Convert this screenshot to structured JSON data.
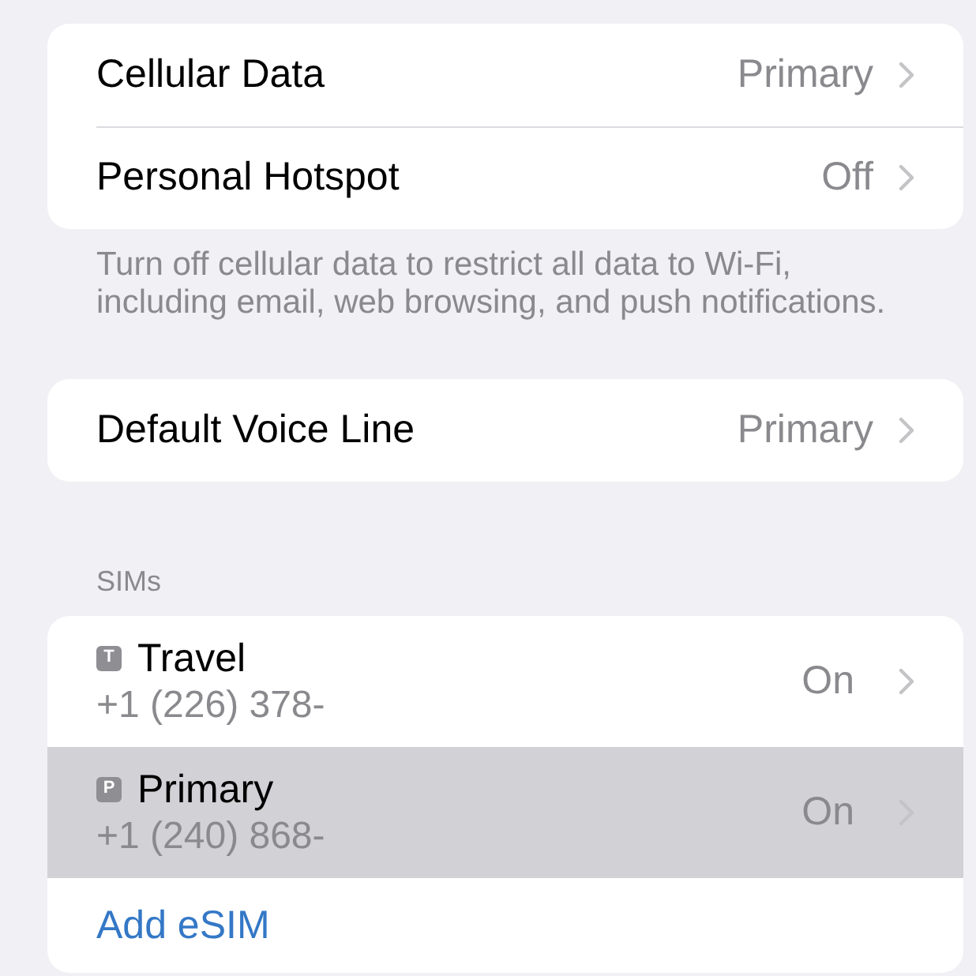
{
  "groups": [
    {
      "rows": [
        {
          "kind": "setting",
          "label": "Cellular Data",
          "value": "Primary"
        },
        {
          "kind": "setting",
          "label": "Personal Hotspot",
          "value": "Off"
        }
      ],
      "footer": "Turn off cellular data to restrict all data to Wi-Fi, including email, web browsing, and push notifications."
    },
    {
      "rows": [
        {
          "kind": "setting",
          "label": "Default Voice Line",
          "value": "Primary"
        }
      ]
    },
    {
      "header": "SIMs",
      "rows": [
        {
          "kind": "sim",
          "badge": "T",
          "label": "Travel",
          "number": "+1 (226) 378-",
          "value": "On",
          "selected": false
        },
        {
          "kind": "sim",
          "badge": "P",
          "label": "Primary",
          "number": "+1 (240) 868-",
          "value": "On",
          "selected": true
        },
        {
          "kind": "action",
          "label": "Add eSIM",
          "selected": false
        }
      ]
    }
  ]
}
